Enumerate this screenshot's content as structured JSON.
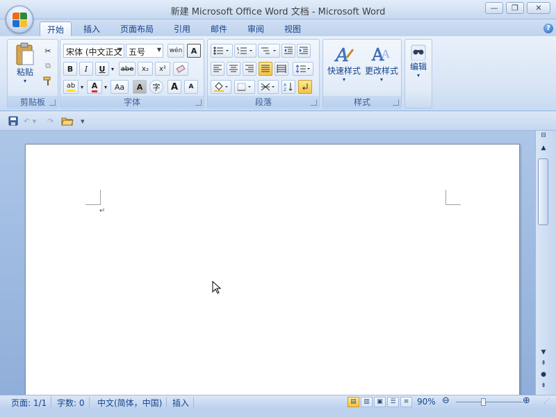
{
  "window": {
    "title": "新建 Microsoft Office Word 文档 - Microsoft Word",
    "minimize": "—",
    "restore": "❐",
    "close": "✕"
  },
  "tabs": [
    "开始",
    "插入",
    "页面布局",
    "引用",
    "邮件",
    "审阅",
    "视图"
  ],
  "active_tab": "开始",
  "ribbon": {
    "clipboard": {
      "label": "剪贴板",
      "paste": "粘贴"
    },
    "font": {
      "label": "字体",
      "font_name": "宋体 (中文正文",
      "font_size": "五号",
      "wen": "wén",
      "bold": "B",
      "italic": "I",
      "underline": "U",
      "strike": "abe",
      "subscript": "x₂",
      "superscript": "x²",
      "aa": "Aa",
      "grow": "A",
      "shrink": "A"
    },
    "paragraph": {
      "label": "段落"
    },
    "styles": {
      "label": "样式",
      "quick_styles": "快速样式",
      "change_styles": "更改样式"
    },
    "editing": {
      "label": "编辑"
    }
  },
  "statusbar": {
    "page": "页面: 1/1",
    "words": "字数: 0",
    "language": "中文(简体，中国)",
    "mode": "插入",
    "zoom": "90%"
  },
  "colors": {
    "accent": "#15428b",
    "highlight": "#f8c23f",
    "ribbon": "#dae6f6"
  }
}
